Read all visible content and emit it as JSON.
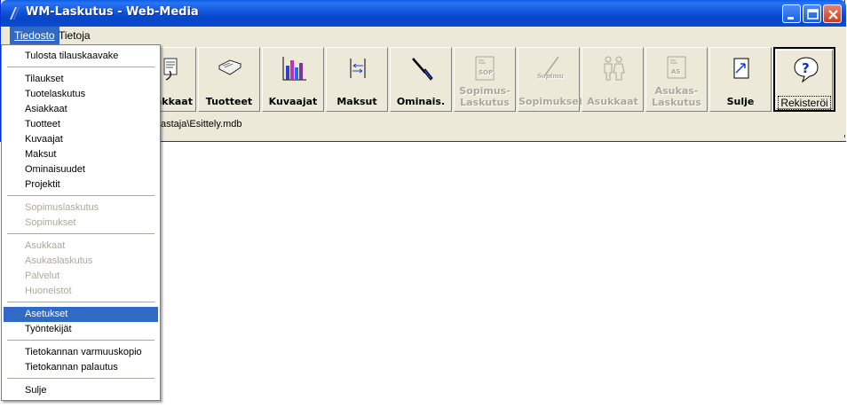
{
  "window": {
    "title": "WM-Laskutus - Web-Media"
  },
  "menubar": {
    "items": [
      {
        "label": "Tiedosto",
        "active": true
      },
      {
        "label": "Tietoja",
        "active": false
      }
    ]
  },
  "toolbar": {
    "buttons": [
      {
        "label": "akkaat",
        "icon": "orders-icon"
      },
      {
        "label": "Tuotteet",
        "icon": "book-icon"
      },
      {
        "label": "Kuvaajat",
        "icon": "bar-chart-icon"
      },
      {
        "label": "Maksut",
        "icon": "payment-icon"
      },
      {
        "label": "Ominais.",
        "icon": "tools-icon"
      },
      {
        "label": "Sopimus-\nLaskutus",
        "icon": "contract-invoice-icon",
        "disabled": true,
        "icon_text": "SOP"
      },
      {
        "label": "Sopimukset",
        "icon": "signature-icon",
        "disabled": true,
        "icon_text": "Sopimus"
      },
      {
        "label": "Asukkaat",
        "icon": "residents-icon",
        "disabled": true
      },
      {
        "label": "Asukas-\nLaskutus",
        "icon": "resident-invoice-icon",
        "disabled": true,
        "icon_text": "AS"
      },
      {
        "label": "Sulje",
        "icon": "exit-door-icon"
      },
      {
        "label": "Rekisteröi",
        "icon": "help-bubble-icon",
        "default": true
      }
    ]
  },
  "status": {
    "path": "astaja\\Esittely.mdb"
  },
  "dropdown": {
    "groups": [
      [
        {
          "label": "Tulosta tilauskaavake",
          "disabled": false
        }
      ],
      [
        {
          "label": "Tilaukset",
          "disabled": false
        },
        {
          "label": "Tuotelaskutus",
          "disabled": false
        },
        {
          "label": "Asiakkaat",
          "disabled": false
        },
        {
          "label": "Tuotteet",
          "disabled": false
        },
        {
          "label": "Kuvaajat",
          "disabled": false
        },
        {
          "label": "Maksut",
          "disabled": false
        },
        {
          "label": "Ominaisuudet",
          "disabled": false
        },
        {
          "label": "Projektit",
          "disabled": false
        }
      ],
      [
        {
          "label": "Sopimuslaskutus",
          "disabled": true
        },
        {
          "label": "Sopimukset",
          "disabled": true
        }
      ],
      [
        {
          "label": "Asukkaat",
          "disabled": true
        },
        {
          "label": "Asukaslaskutus",
          "disabled": true
        },
        {
          "label": "Palvelut",
          "disabled": true
        },
        {
          "label": "Huoneistot",
          "disabled": true
        }
      ],
      [
        {
          "label": "Asetukset",
          "disabled": false,
          "highlighted": true
        },
        {
          "label": "Työntekijät",
          "disabled": false
        }
      ],
      [
        {
          "label": "Tietokannan varmuuskopio",
          "disabled": false
        },
        {
          "label": "Tietokannan palautus",
          "disabled": false
        }
      ],
      [
        {
          "label": "Sulje",
          "disabled": false
        }
      ]
    ]
  },
  "colors": {
    "accent": "#316ac5",
    "titlebar": "#0a4ccd",
    "face": "#ece9d8",
    "disabled_text": "#aca899"
  }
}
